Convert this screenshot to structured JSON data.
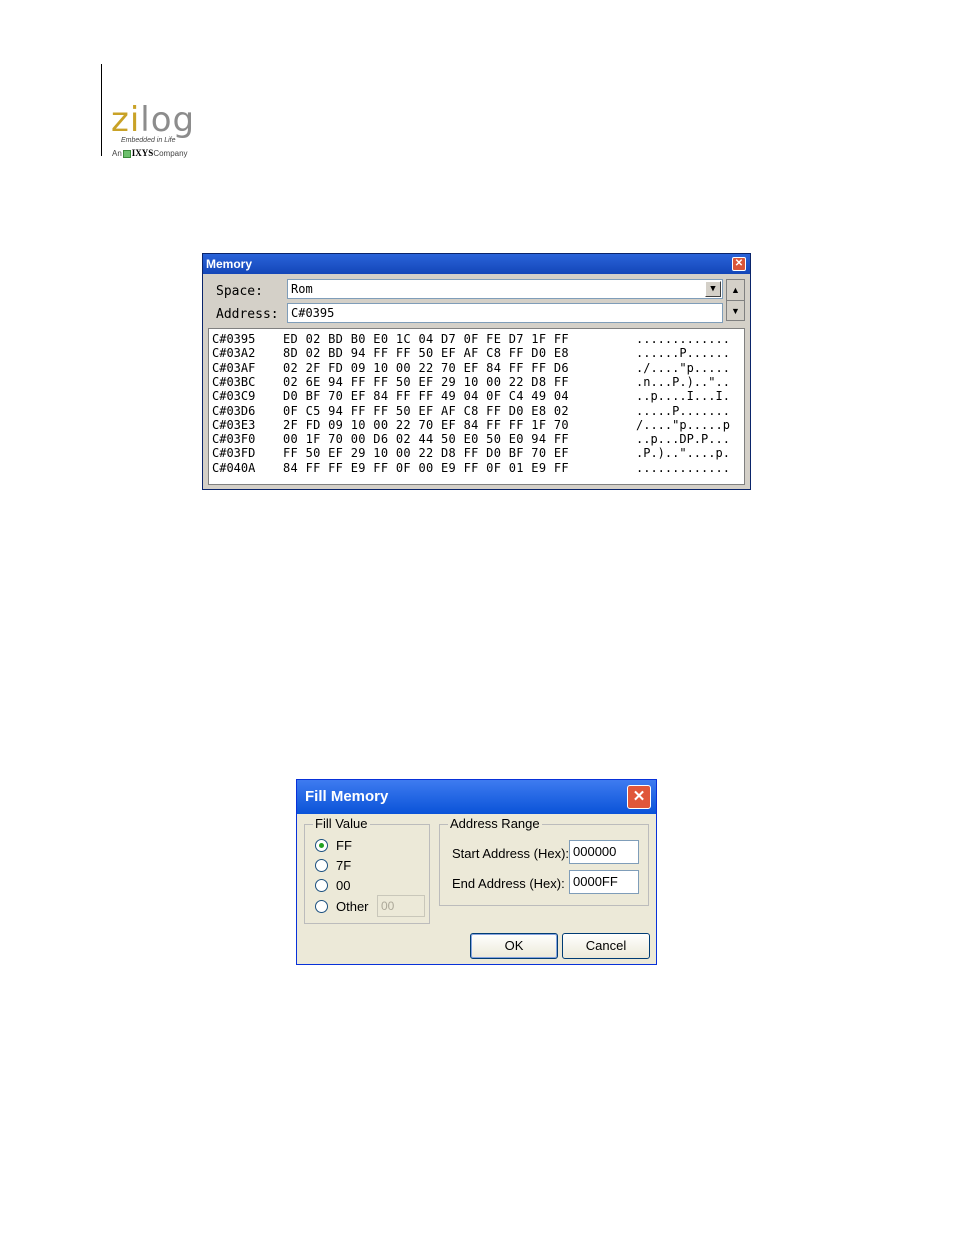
{
  "logo": {
    "brand": "zilog",
    "brand_accent": "zi",
    "brand_rest": "log",
    "tagline": "Embedded in Life",
    "company_prefix": "An",
    "company_name": "IXYS",
    "company_suffix": "Company"
  },
  "memory_window": {
    "title": "Memory",
    "space_label": "Space:",
    "space_value": "Rom",
    "address_label": "Address:",
    "address_value": "C#0395",
    "rows": [
      {
        "addr": "C#0395",
        "hex": "ED 02 BD B0 E0 1C 04 D7 0F FE D7 1F FF",
        "ascii": "............."
      },
      {
        "addr": "C#03A2",
        "hex": "8D 02 BD 94 FF FF 50 EF AF C8 FF D0 E8",
        "ascii": "......P......"
      },
      {
        "addr": "C#03AF",
        "hex": "02 2F FD 09 10 00 22 70 EF 84 FF FF D6",
        "ascii": "./....\"p....."
      },
      {
        "addr": "C#03BC",
        "hex": "02 6E 94 FF FF 50 EF 29 10 00 22 D8 FF",
        "ascii": ".n...P.)..\".."
      },
      {
        "addr": "C#03C9",
        "hex": "D0 BF 70 EF 84 FF FF 49 04 0F C4 49 04",
        "ascii": "..p....I...I."
      },
      {
        "addr": "C#03D6",
        "hex": "0F C5 94 FF FF 50 EF AF C8 FF D0 E8 02",
        "ascii": ".....P......."
      },
      {
        "addr": "C#03E3",
        "hex": "2F FD 09 10 00 22 70 EF 84 FF FF 1F 70",
        "ascii": "/....\"p.....p"
      },
      {
        "addr": "C#03F0",
        "hex": "00 1F 70 00 D6 02 44 50 E0 50 E0 94 FF",
        "ascii": "..p...DP.P..."
      },
      {
        "addr": "C#03FD",
        "hex": "FF 50 EF 29 10 00 22 D8 FF D0 BF 70 EF",
        "ascii": ".P.)..\"....p."
      },
      {
        "addr": "C#040A",
        "hex": "84 FF FF E9 FF 0F 00 E9 FF 0F 01 E9 FF",
        "ascii": "............."
      }
    ]
  },
  "fill_dialog": {
    "title": "Fill Memory",
    "fill_value_group": "Fill Value",
    "options": [
      {
        "label": "FF",
        "selected": true
      },
      {
        "label": "7F",
        "selected": false
      },
      {
        "label": "00",
        "selected": false
      },
      {
        "label": "Other",
        "selected": false
      }
    ],
    "other_value": "00",
    "address_range_group": "Address Range",
    "start_label": "Start Address (Hex):",
    "start_value": "000000",
    "end_label": "End Address (Hex):",
    "end_value": "0000FF",
    "ok_label": "OK",
    "cancel_label": "Cancel"
  }
}
